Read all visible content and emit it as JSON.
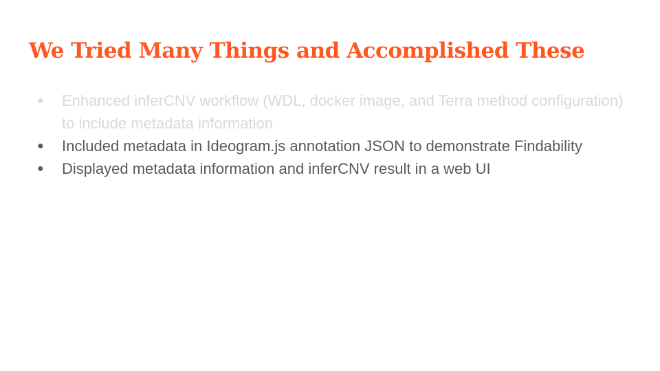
{
  "slide": {
    "title": "We Tried Many Things and Accomplished These",
    "colors": {
      "title": "#ff5722",
      "text": "#595959",
      "faded_text": "#d9d9d9",
      "background": "#ffffff"
    },
    "bullets": [
      {
        "text": "Enhanced inferCNV workflow (WDL, docker image, and Terra method configuration) to include metadata information",
        "faded": true
      },
      {
        "text": "Included metadata in Ideogram.js annotation JSON to demonstrate Findability",
        "faded": false
      },
      {
        "text": "Displayed metadata information and inferCNV result in a web UI",
        "faded": false
      }
    ]
  }
}
